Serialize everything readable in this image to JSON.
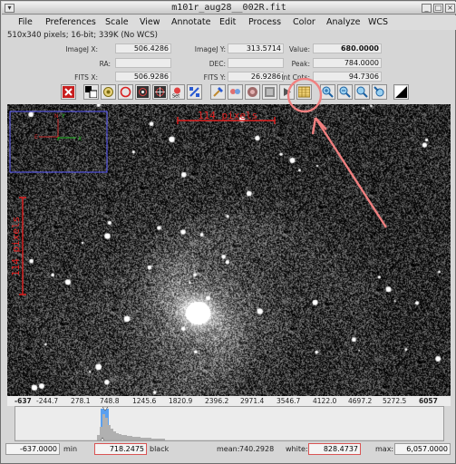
{
  "window": {
    "title": "m101r_aug28__002R.fit"
  },
  "menu": [
    "File",
    "Preferences",
    "Scale",
    "View",
    "Annotate",
    "Edit",
    "Process",
    "Color",
    "Analyze",
    "WCS"
  ],
  "info_line": "510x340 pixels; 16-bit; 339K (No WCS)",
  "readouts": {
    "imagej_x_label": "ImageJ X:",
    "imagej_x": "506.4286",
    "imagej_y_label": "ImageJ Y:",
    "imagej_y": "313.5714",
    "value_label": "Value:",
    "value": "680.0000",
    "ra_label": "RA:",
    "ra": "",
    "dec_label": "DEC:",
    "dec": "",
    "peak_label": "Peak:",
    "peak": "784.0000",
    "fits_x_label": "FITS X:",
    "fits_x": "506.9286",
    "fits_y_label": "FITS Y:",
    "fits_y": "26.9286",
    "int_cnts_label": "Int Cnts:",
    "int_cnts": "94.7306"
  },
  "toolbar_icons": [
    "close-red-x-icon",
    "color-swatch-icon",
    "aperture-settings-icon",
    "ring-red-icon",
    "aperture-photometry-icon",
    "centroid-icon",
    "set-scale-icon",
    "satellite-icon",
    "clear-icon",
    "measure-icon",
    "filter-icon",
    "smooth-icon",
    "arrow-icon",
    "table-icon",
    "zoom-in-icon",
    "zoom-out-icon",
    "zoom-fit-icon",
    "zoom-reset-icon",
    "contrast-icon"
  ],
  "image": {
    "annotation_horizontal": "114 pixels",
    "annotation_vertical": "114 pixels",
    "compass_north": "N",
    "compass_east": "E",
    "compass_x": "X",
    "compass_y": "Y",
    "highlight_color": "#f08080"
  },
  "histogram_axis": [
    "-637",
    "-244.7",
    "278.1",
    "748.8",
    "1245.6",
    "1820.9",
    "2396.2",
    "2971.4",
    "3546.7",
    "4122.0",
    "4697.2",
    "5272.5",
    "6057"
  ],
  "bottom": {
    "min_value": "-637.0000",
    "min_label": "min",
    "black_value": "718.2475",
    "black_label": "black",
    "mean_label": "mean:",
    "mean_value": "740.2928",
    "white_label": "white:",
    "white_value": "828.4737",
    "max_label": "max:",
    "max_value": "6,057.0000"
  }
}
